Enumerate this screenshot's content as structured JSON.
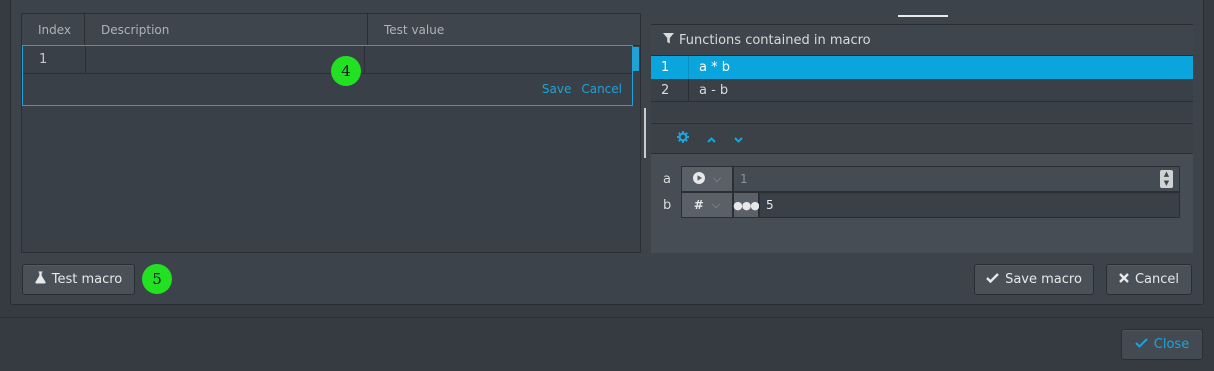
{
  "params_table": {
    "columns": [
      "Index",
      "Description",
      "Test value"
    ],
    "editing_row": {
      "index": "1",
      "description": "",
      "test_value": ""
    },
    "save_label": "Save",
    "cancel_label": "Cancel"
  },
  "badges": {
    "edit_row": "4",
    "test_macro": "5"
  },
  "buttons": {
    "test_macro": "Test macro",
    "save_macro": "Save macro",
    "cancel": "Cancel",
    "close": "Close"
  },
  "functions_panel": {
    "title": "Functions contained in macro",
    "rows": [
      {
        "index": "1",
        "expression": "a * b",
        "selected": true
      },
      {
        "index": "2",
        "expression": "a - b",
        "selected": false
      }
    ]
  },
  "arguments": [
    {
      "name": "a",
      "type_icon": "play-circle-icon",
      "value": "1",
      "disabled": true
    },
    {
      "name": "b",
      "type_icon": "hash-icon",
      "value": "5",
      "disabled": false
    }
  ],
  "colors": {
    "accent": "#0aa5dc",
    "badge": "#22e022",
    "background": "#363b42"
  }
}
